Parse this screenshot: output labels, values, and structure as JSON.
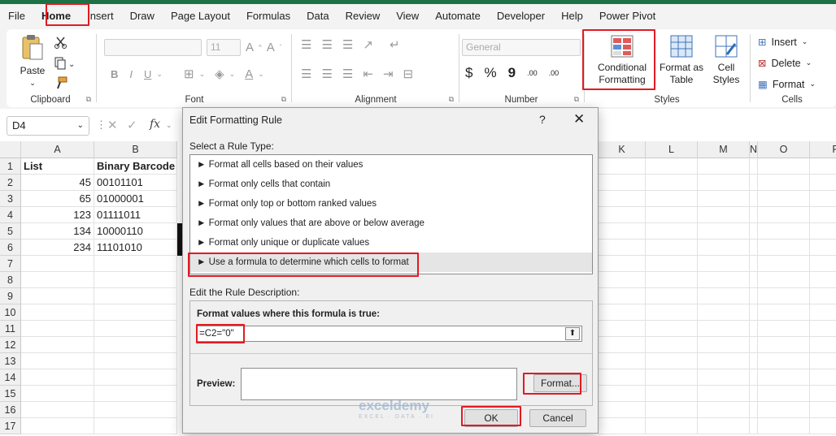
{
  "menu": {
    "items": [
      "File",
      "Home",
      "Insert",
      "Draw",
      "Page Layout",
      "Formulas",
      "Data",
      "Review",
      "View",
      "Automate",
      "Developer",
      "Help",
      "Power Pivot"
    ]
  },
  "ribbon": {
    "clipboard": {
      "paste_label": "Paste",
      "group_label": "Clipboard"
    },
    "font": {
      "font_name": "",
      "font_size": "11",
      "bold": "B",
      "italic": "I",
      "underline": "U",
      "group_label": "Font"
    },
    "alignment": {
      "group_label": "Alignment"
    },
    "number": {
      "format": "General",
      "currency": "$",
      "percent": "%",
      "comma": "9",
      "inc_decimal": ".00",
      "dec_decimal": ".00",
      "group_label": "Number"
    },
    "styles": {
      "conditional_label_1": "Conditional",
      "conditional_label_2": "Formatting",
      "format_table_1": "Format as",
      "format_table_2": "Table",
      "cell_styles_1": "Cell",
      "cell_styles_2": "Styles",
      "group_label": "Styles"
    },
    "cells": {
      "insert": "Insert",
      "delete": "Delete",
      "format": "Format",
      "group_label": "Cells"
    }
  },
  "formula_bar": {
    "name_box": "D4",
    "cancel": "✕",
    "enter": "✓",
    "fx": "fx"
  },
  "grid": {
    "columns_left": [
      "A",
      "B"
    ],
    "columns_right": [
      "K",
      "L",
      "M",
      "N",
      "O",
      "P"
    ],
    "rows": [
      "1",
      "2",
      "3",
      "4",
      "5",
      "6",
      "7",
      "8",
      "9",
      "10",
      "11",
      "12",
      "13",
      "14",
      "15",
      "16",
      "17"
    ],
    "header_row": {
      "a": "List",
      "b": "Binary Barcode"
    },
    "data": [
      {
        "a": "45",
        "b": "00101101"
      },
      {
        "a": "65",
        "b": "01000001"
      },
      {
        "a": "123",
        "b": "01111011"
      },
      {
        "a": "134",
        "b": "10000110"
      },
      {
        "a": "234",
        "b": "11101010"
      }
    ]
  },
  "dialog": {
    "title": "Edit Formatting Rule",
    "help": "?",
    "close": "✕",
    "select_rule_label": "Select a Rule Type:",
    "rule_bullet": "►",
    "rule_types": [
      "Format all cells based on their values",
      "Format only cells that contain",
      "Format only top or bottom ranked values",
      "Format only values that are above or below average",
      "Format only unique or duplicate values",
      "Use a formula to determine which cells to format"
    ],
    "edit_desc_label": "Edit the Rule Description:",
    "formula_label": "Format values where this formula is true:",
    "formula_value": "=C2=\"0\"",
    "preview_label": "Preview:",
    "format_button": "Format...",
    "ok_button": "OK",
    "cancel_button": "Cancel"
  },
  "watermark": {
    "name": "exceldemy",
    "tagline": "EXCEL · DATA · BI"
  },
  "colors": {
    "excel_green": "#1e7145",
    "highlight_red": "#e01b24"
  }
}
